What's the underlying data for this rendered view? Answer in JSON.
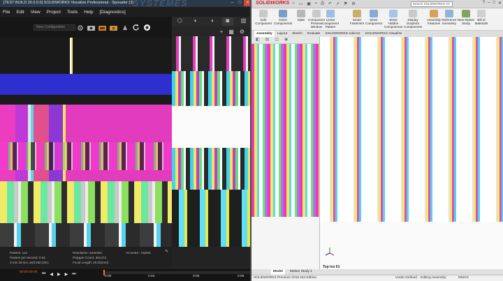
{
  "visualize": {
    "window_title": "[TEST BUILD 26.0.0.0] SOLIDWORKS Visualize Professional - Spreader (3)",
    "watermark": "SYSTEMES",
    "menu": [
      "File",
      "Edit",
      "View",
      "Project",
      "Tools",
      "Help",
      "[Diagnostics]"
    ],
    "config_dropdown": "New Configuration",
    "stats": {
      "passes": "Passes: 112",
      "passes_per_sec": "Passes per second: 0.63",
      "time": "3 min 38 sec until 250 (OK)",
      "resolution": "Resolution: 644x362",
      "polygon_count": "Polygon Count: 361472",
      "focal_length": "Focal Length: 29.02(mm)",
      "render_mode": "Accurate - Hybrid"
    },
    "timeline": {
      "time_left": "00:00:00.00",
      "labels": [
        "0:00",
        "0:03",
        "0:06",
        "0:09"
      ],
      "position": 0.0
    }
  },
  "solidworks": {
    "logo": "SOLIDWORKS",
    "search_placeholder": "Search SOLIDWORKS He",
    "ribbon": [
      {
        "label": "Edit Component",
        "icon": "edit-component-icon",
        "color": "#c9c9c9"
      },
      {
        "label": "Insert Components",
        "icon": "insert-components-icon",
        "color": "#7d9cc7"
      },
      {
        "label": "Mate",
        "icon": "mate-icon",
        "color": "#b7b7b7"
      },
      {
        "label": "Component Preview Window",
        "icon": "component-preview-icon",
        "color": "#c9c9c9"
      },
      {
        "label": "Linear Component Pattern",
        "icon": "linear-pattern-icon",
        "color": "#9dbde2"
      },
      {
        "label": "Smart Fasteners",
        "icon": "smart-fasteners-icon",
        "color": "#c8b06a"
      },
      {
        "label": "Move Component",
        "icon": "move-component-icon",
        "color": "#88a9d2"
      },
      {
        "label": "Show Hidden Components",
        "icon": "show-hidden-icon",
        "color": "#a7c4e6"
      },
      {
        "label": "Display Graphics Components",
        "icon": "display-graphics-icon",
        "color": "#c9c9c9"
      },
      {
        "label": "Assembly Features",
        "icon": "assembly-features-icon",
        "color": "#d6a15a"
      },
      {
        "label": "Reference Geometry",
        "icon": "reference-geometry-icon",
        "color": "#8fb2da"
      },
      {
        "label": "New Motion Study",
        "icon": "motion-study-icon",
        "color": "#7fa55e"
      },
      {
        "label": "Bill of Materials",
        "icon": "bill-of-materials-icon",
        "color": "#cfcfcf"
      }
    ],
    "command_tabs": [
      "Assembly",
      "Layout",
      "Sketch",
      "Evaluate",
      "SOLIDWORKS Add-Ins",
      "SOLIDWORKS Visualize"
    ],
    "view_label": "Top Iso 61",
    "model_tabs": [
      "Model",
      "Motion Study 1"
    ],
    "status": {
      "product": "SOLIDWORKS Premium 2018 x64 Edition",
      "state": "Under Defined",
      "mode": "Editing Assembly",
      "units": "MMGS"
    }
  }
}
